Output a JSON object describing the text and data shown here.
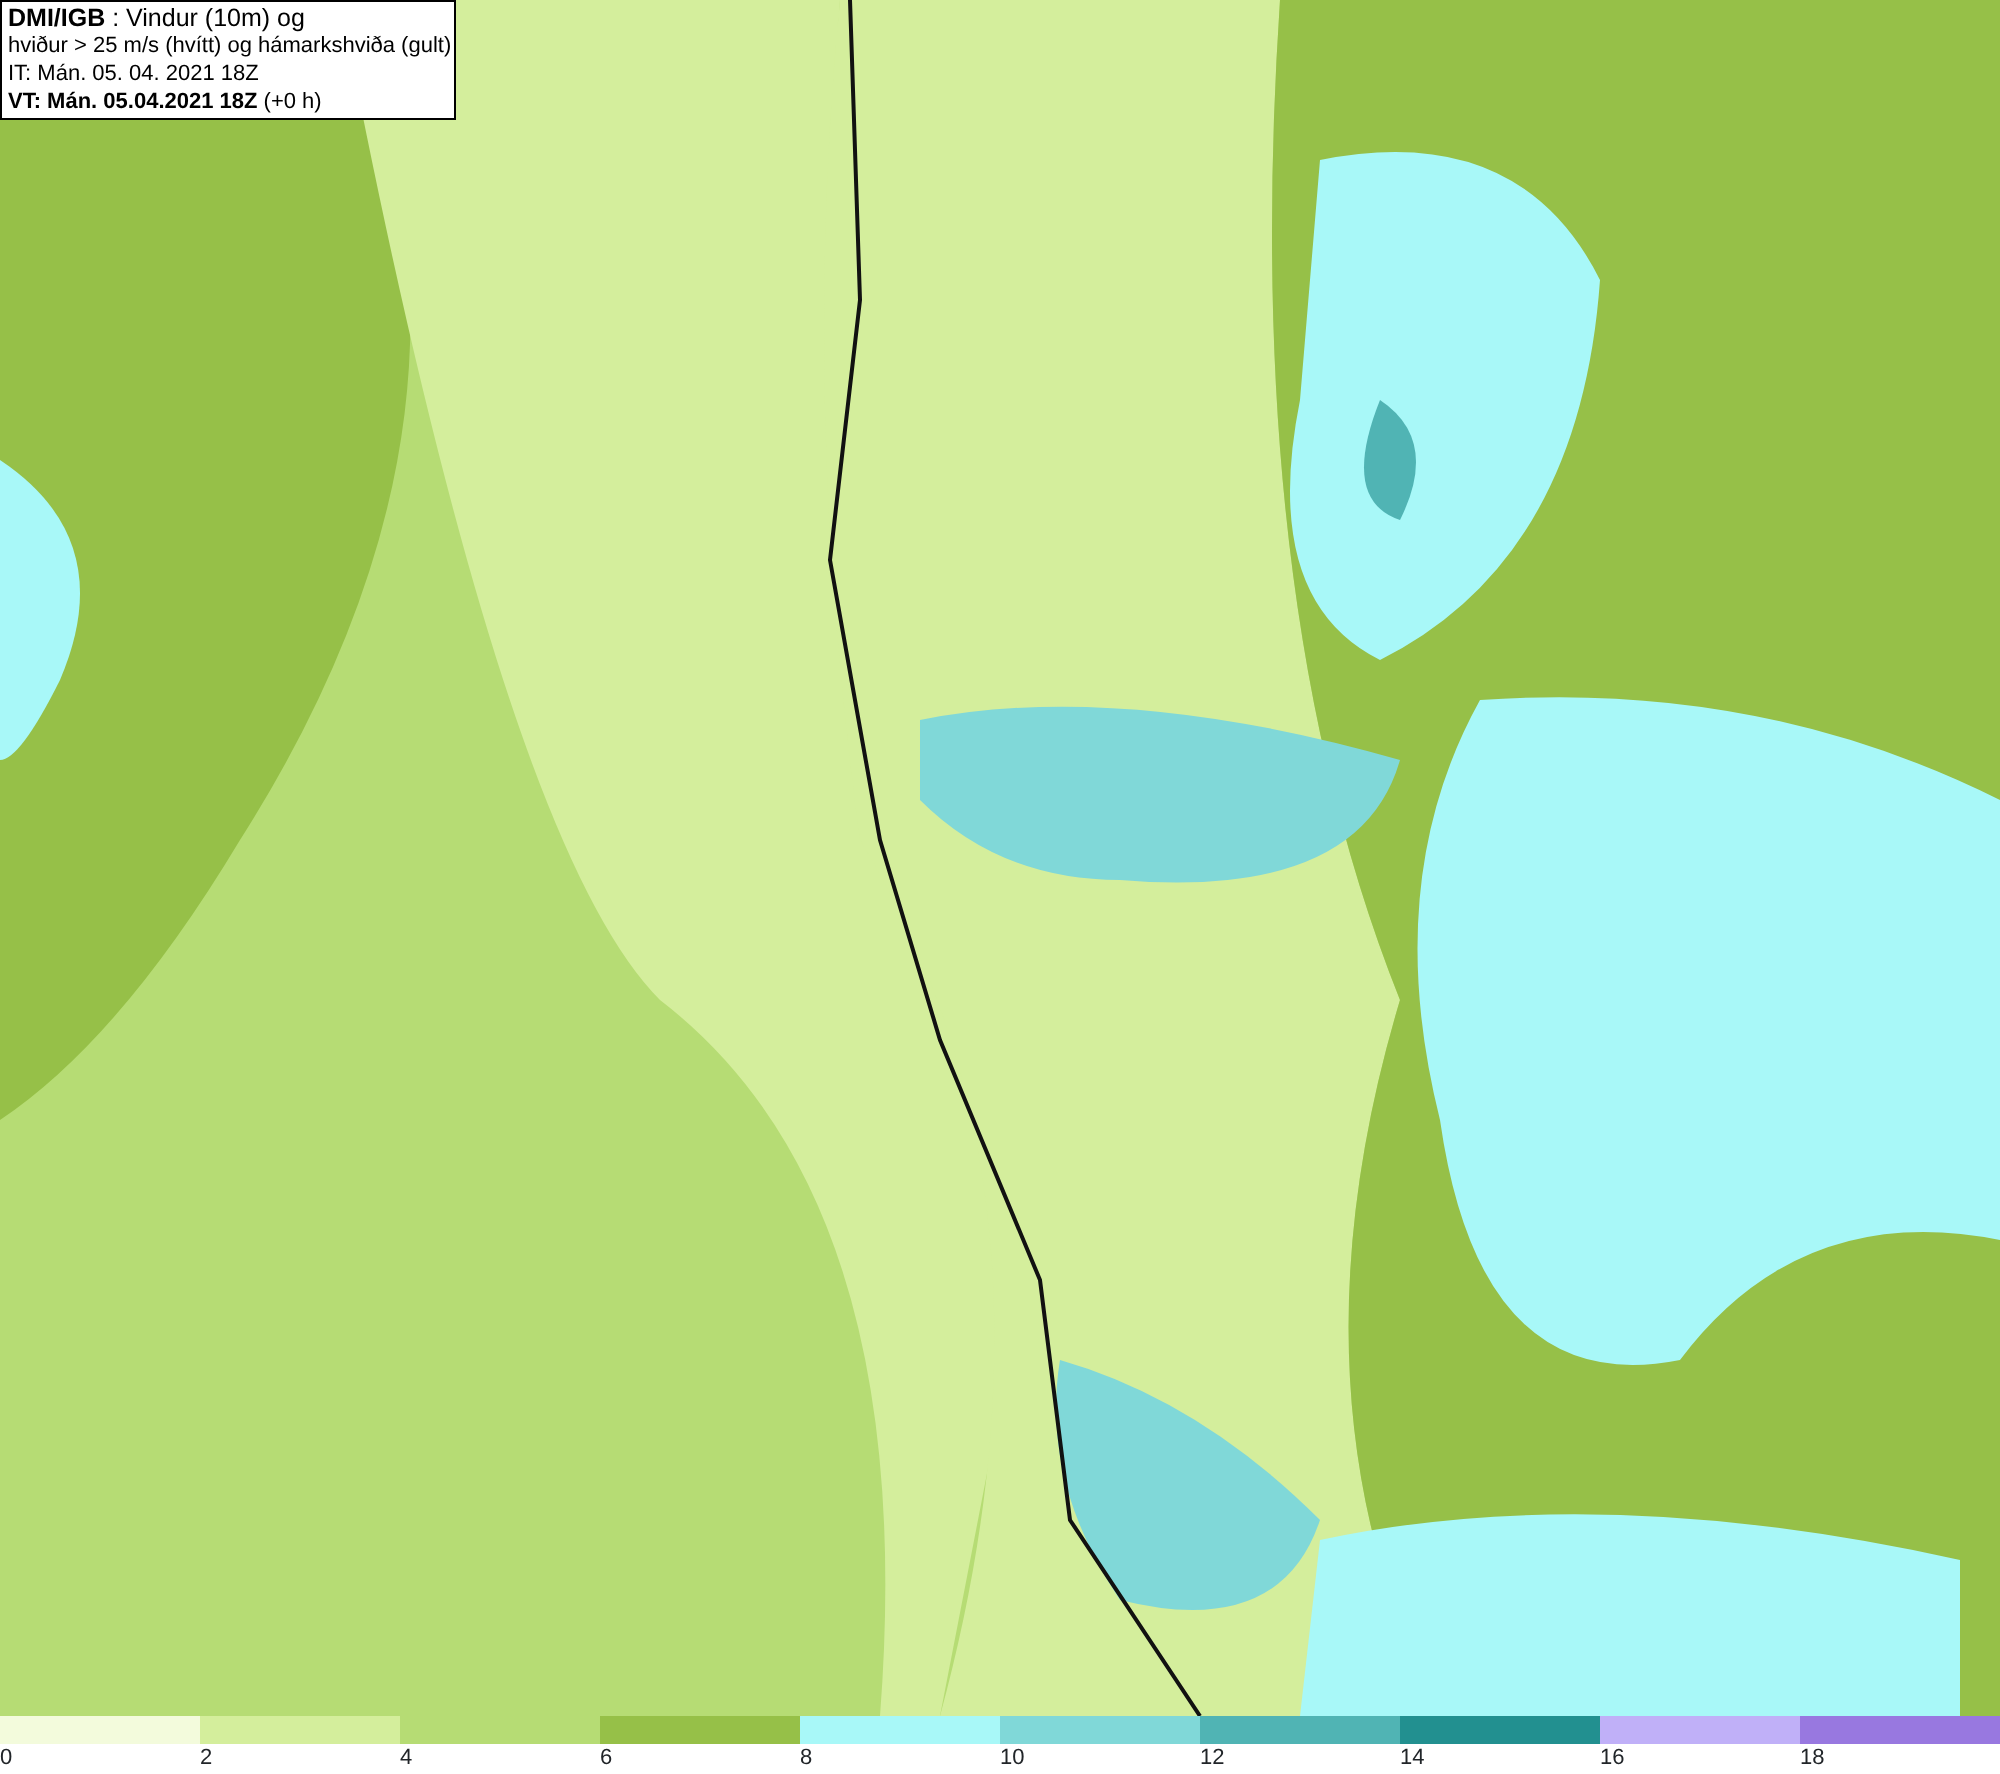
{
  "title_box": {
    "lines": [
      "**DMI/IGB** : Vindur (10m) og",
      "hviður > 25 m/s (hvítt) og hámarkshviða (gult)",
      "IT: Mán. 05. 04. 2021 18Z",
      "**VT: Mán. 05.04.2021 18Z** (+0 h)"
    ]
  },
  "legend": [
    {
      "label": "0",
      "color": "#f3fbdc"
    },
    {
      "label": "2",
      "color": "#d4ee9c"
    },
    {
      "label": "4",
      "color": "#b6dc74"
    },
    {
      "label": "6",
      "color": "#96c048"
    },
    {
      "label": "8",
      "color": "#a8f8f8"
    },
    {
      "label": "10",
      "color": "#80d8d8"
    },
    {
      "label": "12",
      "color": "#50b4b4"
    },
    {
      "label": "14",
      "color": "#229090"
    },
    {
      "label": "16",
      "color": "#c0b0f8"
    },
    {
      "label": "18",
      "color": "#9878e0"
    }
  ]
}
